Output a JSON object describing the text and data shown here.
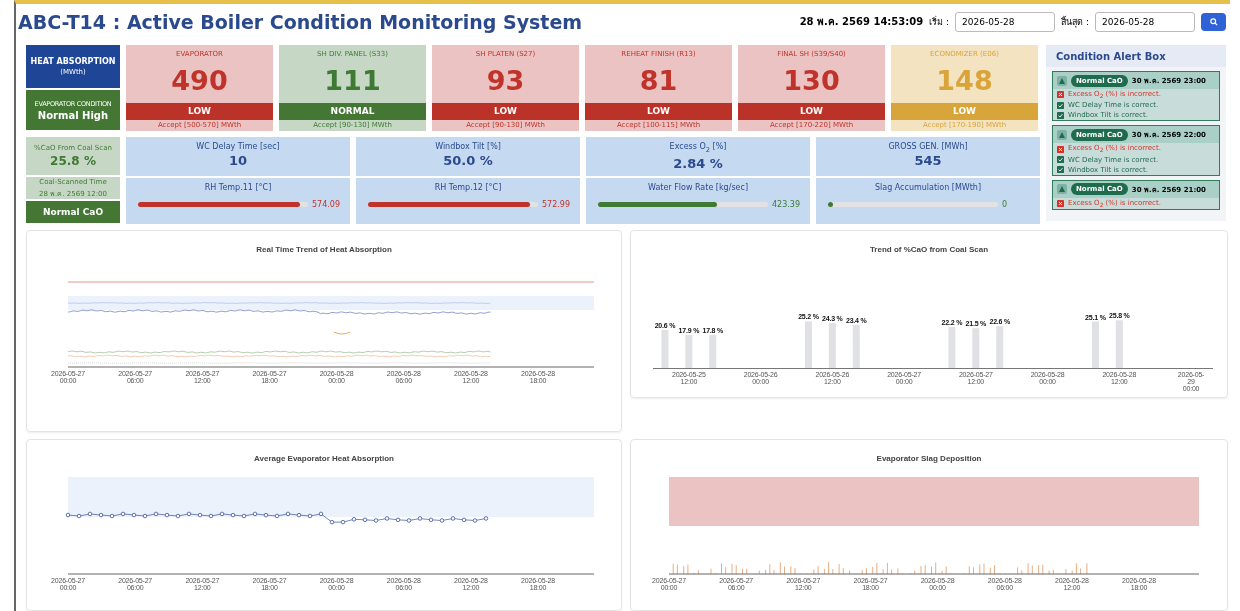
{
  "header": {
    "title": "ABC-T14 : Active Boiler Condition Monitoring System",
    "datetime": "28 พ.ค. 2569 14:53:09",
    "start_label": "เริ่ม :",
    "start_value": "2026-05-28",
    "end_label": "สิ้นสุด :",
    "end_value": "2026-05-28"
  },
  "heat_absorption": {
    "title": "HEAT ABSORPTION",
    "unit": "(MWth)",
    "condition_label": "EVAPORATOR CONDITION",
    "condition_value": "Normal High"
  },
  "metric_cards": [
    {
      "label": "EVAPORATOR",
      "value": "490",
      "status": "LOW",
      "accept": "Accept [500-570] MWth",
      "kind": "alarm"
    },
    {
      "label": "SH DIV. PANEL (S33)",
      "value": "111",
      "status": "NORMAL",
      "accept": "Accept [90-130] MWth",
      "kind": "normal"
    },
    {
      "label": "SH PLATEN (S27)",
      "value": "93",
      "status": "LOW",
      "accept": "Accept [90-130] MWth",
      "kind": "alarm"
    },
    {
      "label": "REHEAT FINISH (R13)",
      "value": "81",
      "status": "LOW",
      "accept": "Accept [100-115] MWth",
      "kind": "alarm"
    },
    {
      "label": "FINAL SH (S39/S40)",
      "value": "130",
      "status": "LOW",
      "accept": "Accept [170-220] MWth",
      "kind": "alarm"
    },
    {
      "label": "ECONOMIZER (E06)",
      "value": "148",
      "status": "LOW",
      "accept": "Accept [170-190] MWth",
      "kind": "warning"
    }
  ],
  "cao": {
    "label": "%CaO From Coal Scan",
    "value": "25.8 %",
    "scan_label": "Coal-Scanned Time",
    "scan_time": "28 พ.ค. 2569 12:00",
    "status": "Normal CaO"
  },
  "readings": [
    {
      "kind": "value",
      "label": "WC Delay Time [sec]",
      "value": "10"
    },
    {
      "kind": "value",
      "label": "Windbox Tilt [%]",
      "value": "50.0 %"
    },
    {
      "kind": "value",
      "label": "Excess O$_{2}$ [%]",
      "value": "2.84 %"
    },
    {
      "kind": "value",
      "label": "GROSS GEN. [MWh]",
      "value": "545"
    },
    {
      "kind": "bar",
      "label": "RH Temp.11 [°C]",
      "value": "574.09",
      "level": 0.95,
      "color": "#c0332b"
    },
    {
      "kind": "bar",
      "label": "RH Temp.12 [°C]",
      "value": "572.99",
      "level": 0.95,
      "color": "#c0332b"
    },
    {
      "kind": "bar",
      "label": "Water Flow Rate [kg/sec]",
      "value": "423.39",
      "level": 0.7,
      "color": "#3f7a34"
    },
    {
      "kind": "bar",
      "label": "Slag Accumulation [MWth]",
      "value": "0",
      "level": 0,
      "color": "#3f7a34"
    }
  ],
  "alert_box": {
    "title": "Condition Alert Box",
    "alerts": [
      {
        "badge": "Normal CaO",
        "time": "30 พ.ค. 2569 23:00",
        "items": [
          {
            "text": "Excess O$_{2}$ (%) is incorrect.",
            "kind": "error"
          },
          {
            "text": "WC Delay Time is correct.",
            "kind": "ok"
          },
          {
            "text": "Windbox Tilt is correct.",
            "kind": "ok"
          }
        ]
      },
      {
        "badge": "Normal CaO",
        "time": "30 พ.ค. 2569 22:00",
        "items": [
          {
            "text": "Excess O$_{2}$ (%) is incorrect.",
            "kind": "error"
          },
          {
            "text": "WC Delay Time is correct.",
            "kind": "ok"
          },
          {
            "text": "Windbox Tilt is correct.",
            "kind": "ok"
          }
        ]
      },
      {
        "badge": "Normal CaO",
        "time": "30 พ.ค. 2569 21:00",
        "items": [
          {
            "text": "Excess O$_{2}$ (%) is incorrect.",
            "kind": "error"
          }
        ]
      }
    ]
  },
  "charts": [
    {
      "kind": "trend",
      "title": "Real Time Trend of Heat Absorption",
      "x_tick_labels": [
        "2026-05-27\n00:00",
        "2026-05-27\n06:00",
        "2026-05-27\n12:00",
        "2026-05-27\n18:00",
        "2026-05-28\n00:00",
        "2026-05-28\n06:00",
        "2026-05-28\n12:00",
        "2026-05-28\n18:00"
      ]
    },
    {
      "kind": "bar",
      "chart_data": {
        "type": "bar",
        "title": "Trend of %CaO from Coal Scan",
        "categories": [
          null,
          "2026-05-25\n12:00",
          null,
          null,
          "2026-05-26\n00:00",
          null,
          null,
          "2026-05-26\n12:00",
          null,
          null,
          "2026-05-27\n00:00",
          null,
          null,
          "2026-05-27\n12:00",
          null,
          null,
          "2026-05-28\n00:00",
          null,
          null,
          "2026-05-28\n12:00",
          null,
          null,
          "2026-05-29\n00:00"
        ],
        "values": [
          20.6,
          17.9,
          17.8,
          null,
          null,
          null,
          25.2,
          24.3,
          23.4,
          null,
          null,
          null,
          22.2,
          21.5,
          22.6,
          null,
          null,
          null,
          25.1,
          25.8,
          null,
          null,
          null
        ],
        "value_labels": [
          "20.6 %",
          "17.9 %",
          "17.8 %",
          null,
          null,
          null,
          "25.2 %",
          "24.3 %",
          "23.4 %",
          null,
          null,
          null,
          "22.2 %",
          "21.5 %",
          "22.6 %",
          null,
          null,
          null,
          "25.1 %",
          "25.8 %",
          null,
          null,
          null
        ]
      }
    },
    {
      "kind": "dots",
      "title": "Average Evaporator Heat Absorption",
      "x_tick_labels": [
        "2026-05-27\n00:00",
        "2026-05-27\n06:00",
        "2026-05-27\n12:00",
        "2026-05-27\n18:00",
        "2026-05-28\n00:00",
        "2026-05-28\n06:00",
        "2026-05-28\n12:00",
        "2026-05-28\n18:00"
      ]
    },
    {
      "kind": "spikes",
      "title": "Evaporator Slag Deposition",
      "x_tick_labels": [
        "2026-05-27\n00:00",
        "2026-05-27\n06:00",
        "2026-05-27\n12:00",
        "2026-05-27\n18:00",
        "2026-05-28\n00:00",
        "2026-05-28\n06:00",
        "2026-05-28\n12:00",
        "2026-05-28\n18:00"
      ]
    }
  ]
}
